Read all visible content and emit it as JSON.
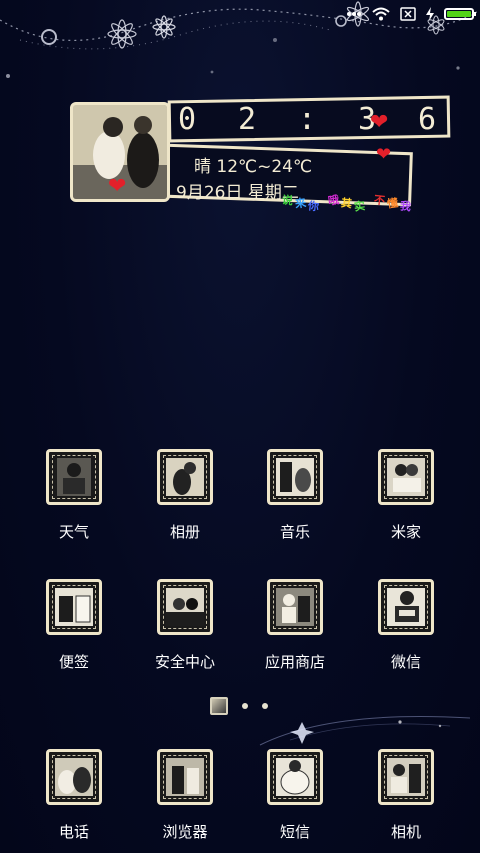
{
  "status_bar": {
    "icons": [
      "dots-icon",
      "wifi-icon",
      "close-box-icon",
      "charging-icon",
      "battery-icon"
    ],
    "battery_level": 1.0,
    "battery_color": "#52d417"
  },
  "widget": {
    "time_digits": [
      "0",
      "2",
      ":",
      "3",
      "6"
    ],
    "weather": "晴 12℃~24℃",
    "date": "9月26日 星期二",
    "scatter_text": [
      "说",
      "来",
      "你",
      "哦",
      "其",
      "实",
      "不",
      "懂",
      "我"
    ],
    "scatter_colors": [
      "#3bd13b",
      "#39a3ff",
      "#4a6bff",
      "#d12bd1",
      "#ffd22b",
      "#5be34b",
      "#e33030",
      "#ff8a2b",
      "#b04cff"
    ]
  },
  "apps_row1": [
    {
      "label": "天气"
    },
    {
      "label": "相册"
    },
    {
      "label": "音乐"
    },
    {
      "label": "米家"
    }
  ],
  "apps_row2": [
    {
      "label": "便签"
    },
    {
      "label": "安全中心"
    },
    {
      "label": "应用商店"
    },
    {
      "label": "微信"
    }
  ],
  "dock": [
    {
      "label": "电话"
    },
    {
      "label": "浏览器"
    },
    {
      "label": "短信"
    },
    {
      "label": "相机"
    }
  ],
  "page_indicator": {
    "pages": 3,
    "current": 1
  },
  "colors": {
    "background": "#060a1f",
    "frame": "#efe6c9",
    "heart": "#e3202a"
  }
}
